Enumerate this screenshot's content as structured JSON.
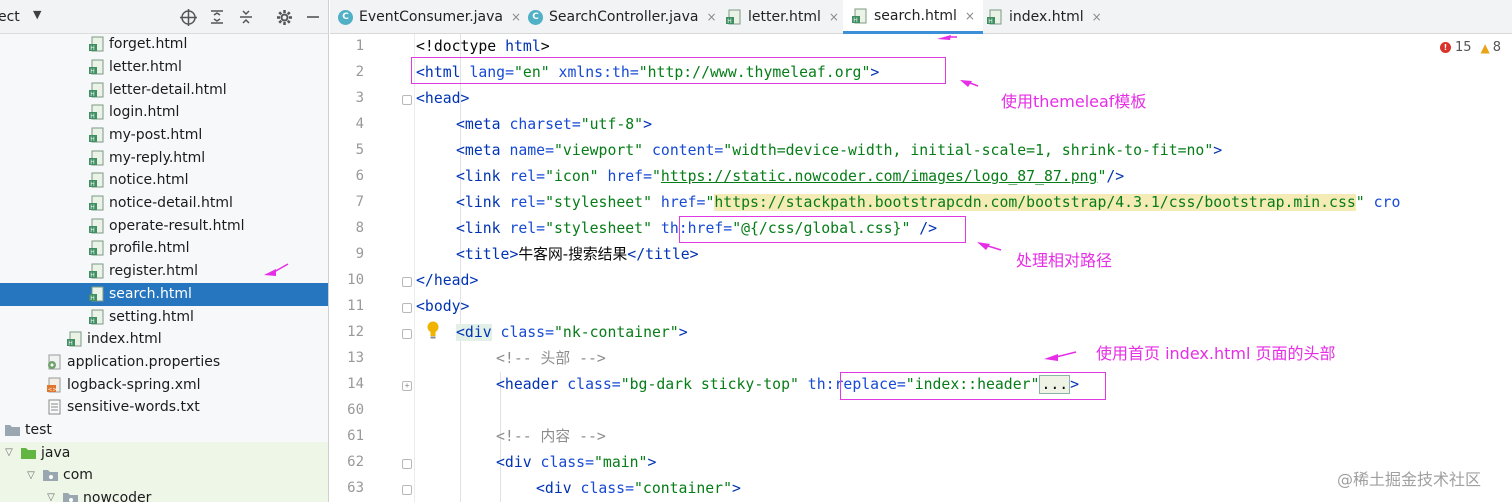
{
  "project_panel": {
    "title": "ect",
    "items": [
      {
        "label": "forget.html",
        "icon": "html-file-icon"
      },
      {
        "label": "letter.html",
        "icon": "html-file-icon"
      },
      {
        "label": "letter-detail.html",
        "icon": "html-file-icon"
      },
      {
        "label": "login.html",
        "icon": "html-file-icon"
      },
      {
        "label": "my-post.html",
        "icon": "html-file-icon"
      },
      {
        "label": "my-reply.html",
        "icon": "html-file-icon"
      },
      {
        "label": "notice.html",
        "icon": "html-file-icon"
      },
      {
        "label": "notice-detail.html",
        "icon": "html-file-icon"
      },
      {
        "label": "operate-result.html",
        "icon": "html-file-icon"
      },
      {
        "label": "profile.html",
        "icon": "html-file-icon"
      },
      {
        "label": "register.html",
        "icon": "html-file-icon"
      },
      {
        "label": "search.html",
        "icon": "html-file-icon",
        "selected": true
      },
      {
        "label": "setting.html",
        "icon": "html-file-icon"
      },
      {
        "label": "index.html",
        "icon": "html-file-icon"
      },
      {
        "label": "application.properties",
        "icon": "properties-file-icon"
      },
      {
        "label": "logback-spring.xml",
        "icon": "xml-file-icon"
      },
      {
        "label": "sensitive-words.txt",
        "icon": "text-file-icon"
      },
      {
        "label": "test",
        "icon": "folder-icon"
      },
      {
        "label": "java",
        "icon": "folder-icon"
      },
      {
        "label": "com",
        "icon": "package-icon"
      },
      {
        "label": "nowcoder",
        "icon": "package-icon"
      }
    ]
  },
  "tabs": [
    {
      "label": "EventConsumer.java",
      "icon": "java-class-icon",
      "active": false
    },
    {
      "label": "SearchController.java",
      "icon": "java-class-icon",
      "active": false
    },
    {
      "label": "letter.html",
      "icon": "html-file-icon",
      "active": false
    },
    {
      "label": "search.html",
      "icon": "html-file-icon",
      "active": true
    },
    {
      "label": "index.html",
      "icon": "html-file-icon",
      "active": false
    }
  ],
  "tab_close_glyph": "×",
  "tab_class_glyph": "C",
  "inspection": {
    "errors": "15",
    "warnings": "8",
    "error_glyph": "!",
    "warning_glyph": "▲"
  },
  "gutter": {
    "line_numbers": [
      "1",
      "2",
      "3",
      "4",
      "5",
      "6",
      "7",
      "8",
      "9",
      "10",
      "11",
      "12",
      "13",
      "14",
      "60",
      "61",
      "62",
      "63"
    ]
  },
  "code": {
    "l1": {
      "a": "<!doctype",
      "b": " html",
      "c": ">"
    },
    "l2": {
      "a": "<html",
      "b": " lang=",
      "c": "\"en\"",
      "d": " xmlns:th=",
      "e": "\"http://www.thymeleaf.org\"",
      "f": ">"
    },
    "l3": {
      "a": "<head>"
    },
    "l4": {
      "a": "<meta",
      "b": " charset=",
      "c": "\"utf-8\"",
      "d": ">"
    },
    "l5": {
      "a": "<meta",
      "b": " name=",
      "c": "\"viewport\"",
      "d": " content=",
      "e": "\"width=device-width, initial-scale=1, shrink-to-fit=no\"",
      "f": ">"
    },
    "l6": {
      "a": "<link",
      "b": " rel=",
      "c": "\"icon\"",
      "d": " href=",
      "e": "\"",
      "f": "https://static.nowcoder.com/images/logo_87_87.png",
      "g": "\"",
      "h": "/>"
    },
    "l7": {
      "a": "<link",
      "b": " rel=",
      "c": "\"stylesheet\"",
      "d": " href=",
      "e": "\"",
      "f": "https://stackpath.bootstrapcdn.com/bootstrap/4.3.1/css/bootstrap.min.css",
      "g": "\"",
      "h": " cro"
    },
    "l8": {
      "a": "<link",
      "b": " rel=",
      "c": "\"stylesheet\"",
      "d": " th:href=",
      "e": "\"@{/css/global.css}\"",
      "f": " />"
    },
    "l9": {
      "a": "<title>",
      "b": "牛客网-搜索结果",
      "c": "</title>"
    },
    "l10": {
      "a": "</head>"
    },
    "l11": {
      "a": "<body>"
    },
    "l12": {
      "a": "<div",
      "b": " class=",
      "c": "\"nk-container\"",
      "d": ">"
    },
    "l13": {
      "a": "<!-- ",
      "b": "头部",
      "c": " -->"
    },
    "l14": {
      "a": "<header",
      "b": " class=",
      "c": "\"bg-dark sticky-top\"",
      "d": " th:replace=",
      "e": "\"index::header\"",
      "f": "...",
      "g": ">"
    },
    "l61": {
      "a": "<!-- ",
      "b": "内容",
      "c": " -->"
    },
    "l62": {
      "a": "<div",
      "b": " class=",
      "c": "\"main\"",
      "d": ">"
    },
    "l63": {
      "a": "<div",
      "b": " class=",
      "c": "\"container\"",
      "d": ">"
    }
  },
  "annotations": {
    "thymeleaf": "使用themeleaf模板",
    "relative_path": "处理相对路径",
    "header": "使用首页 index.html 页面的头部"
  },
  "watermark": "@稀土掘金技术社区",
  "colors": {
    "annotation": "#e52ee5",
    "selection": "#2675bf",
    "tag": "#0033b3",
    "string": "#067d17",
    "attr": "#174ad4"
  }
}
